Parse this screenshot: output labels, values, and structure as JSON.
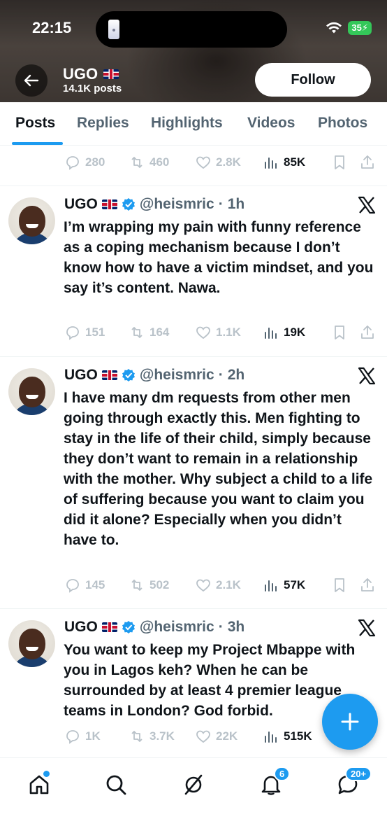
{
  "status": {
    "time": "22:15",
    "battery": "35"
  },
  "profile": {
    "name": "UGO",
    "posts": "14.1K posts",
    "follow_label": "Follow"
  },
  "tabs": [
    "Posts",
    "Replies",
    "Highlights",
    "Videos",
    "Photos"
  ],
  "partial_tweet": {
    "replies": "280",
    "reposts": "460",
    "likes": "2.8K",
    "views": "85K"
  },
  "tweets": [
    {
      "name": "UGO",
      "handle": "@heismric",
      "time": "1h",
      "text": "I’m wrapping my pain with funny reference as a coping mechanism because I don’t know how to have a victim mindset, and you say it’s content. Nawa.",
      "replies": "151",
      "reposts": "164",
      "likes": "1.1K",
      "views": "19K"
    },
    {
      "name": "UGO",
      "handle": "@heismric",
      "time": "2h",
      "text": "I have many dm requests from other men going through exactly this. Men fighting to stay in the life of their child, simply because they don’t want to remain in a relationship with the mother. Why subject a child to a life of suffering because you want to claim you did it alone? Especially when you didn’t have to.",
      "replies": "145",
      "reposts": "502",
      "likes": "2.1K",
      "views": "57K"
    },
    {
      "name": "UGO",
      "handle": "@heismric",
      "time": "3h",
      "text": "You want to keep my Project Mbappe with you in Lagos keh? When he can be surrounded by at least 4 premier league teams in London? God forbid.",
      "replies": "1K",
      "reposts": "3.7K",
      "likes": "22K",
      "views": "515K"
    }
  ],
  "nav": {
    "notifications_badge": "6",
    "messages_badge": "20+"
  },
  "colors": {
    "accent": "#1d9bf0",
    "text": "#0f1419",
    "secondary": "#536471",
    "muted": "#b9c2c9"
  }
}
